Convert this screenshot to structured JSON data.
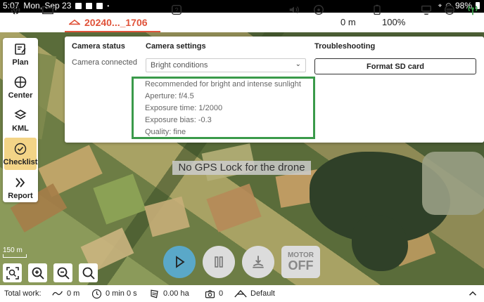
{
  "statusbar": {
    "time": "5:07",
    "date": "Mon, Sep 23",
    "battery": "98%"
  },
  "toolbar": {
    "mission_name": "20240..._1706",
    "altitude": "0 m",
    "drone_battery": "100%"
  },
  "sidenav": {
    "items": [
      {
        "label": "Plan",
        "icon": "plan-icon"
      },
      {
        "label": "Center",
        "icon": "crosshair-icon"
      },
      {
        "label": "KML",
        "icon": "kml-layers-icon"
      },
      {
        "label": "Checklist",
        "icon": "checklist-icon"
      },
      {
        "label": "Report",
        "icon": "report-icon"
      }
    ]
  },
  "camera_panel": {
    "status_header": "Camera status",
    "status_value": "Camera connected",
    "settings_header": "Camera settings",
    "settings_selected": "Bright conditions",
    "troubleshooting_header": "Troubleshooting",
    "format_button": "Format SD card",
    "info": [
      "Recommended for bright and intense sunlight",
      "Aperture: f/4.5",
      "Exposure time: 1/2000",
      "Exposure bias: -0.3",
      "Quality: fine"
    ]
  },
  "map": {
    "gps_message": "No GPS Lock for the drone",
    "scale_label": "150 m"
  },
  "controls": {
    "motor_label_top": "MOTOR",
    "motor_label_bottom": "OFF"
  },
  "bottom_bar": {
    "total_work_label": "Total work:",
    "distance": "0 m",
    "duration": "0 min 0 s",
    "area": "0.00 ha",
    "photos": "0",
    "profile": "Default"
  },
  "colors": {
    "accent": "#e0533a",
    "active_nav": "#f3d487",
    "highlight_border": "#3a9a4a",
    "play_button": "#5aa8c8"
  }
}
